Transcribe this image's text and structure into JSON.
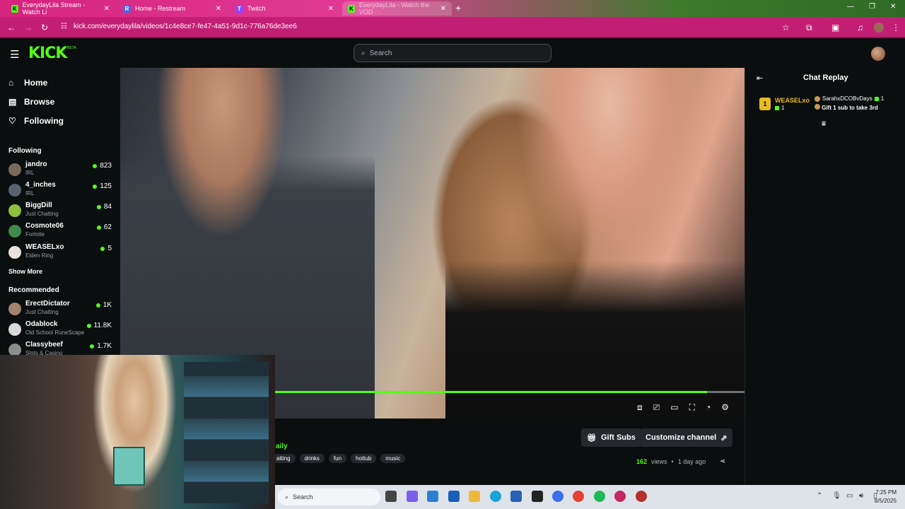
{
  "browser": {
    "tabs": [
      {
        "label": "EverydayLila Stream - Watch Li",
        "fav": "K",
        "fav_color": "#53fc18"
      },
      {
        "label": "Home - Restream",
        "fav": "R",
        "fav_color": "#4a63e6"
      },
      {
        "label": "Twitch",
        "fav": "T",
        "fav_color": "#9146ff"
      },
      {
        "label": "EverydayLila - Watch the VOD",
        "fav": "K",
        "fav_color": "#53fc18"
      }
    ],
    "url": "kick.com/everydaylila/videos/1c4e8ce7-fe47-4a51-9d1c-776a76de3ee6",
    "new_tab": "+"
  },
  "header": {
    "logo": "KICK",
    "beta": "BETA",
    "search_placeholder": "Search"
  },
  "sidebar": {
    "nav": [
      {
        "label": "Home",
        "icon": "home-icon"
      },
      {
        "label": "Browse",
        "icon": "browse-icon"
      },
      {
        "label": "Following",
        "icon": "heart-icon"
      }
    ],
    "following_title": "Following",
    "following": [
      {
        "name": "jandro",
        "category": "IRL",
        "viewers": "823",
        "color": "#7b6a5c"
      },
      {
        "name": "4_inches",
        "category": "IRL",
        "viewers": "125",
        "color": "#596370"
      },
      {
        "name": "BiggDill",
        "category": "Just Chatting",
        "viewers": "84",
        "color": "#8fbf3c"
      },
      {
        "name": "Cosmote06",
        "category": "Fortnite",
        "viewers": "62",
        "color": "#3f8a4a"
      },
      {
        "name": "WEASELxo",
        "category": "Elden Ring",
        "viewers": "5",
        "color": "#e9e3dc"
      }
    ],
    "show_more": "Show More",
    "recommended_title": "Recommended",
    "recommended": [
      {
        "name": "ErectDictator",
        "category": "Just Chatting",
        "viewers": "1K",
        "color": "#a38470"
      },
      {
        "name": "Odablock",
        "category": "Old School RuneScape",
        "viewers": "11.8K",
        "color": "#d9d9d9"
      },
      {
        "name": "Classybeef",
        "category": "Slots & Casino",
        "viewers": "1.7K",
        "color": "#8d8d8d"
      }
    ]
  },
  "video": {
    "progress": 0.94
  },
  "below_video": {
    "gift_subs": "Gift Subs",
    "customize": "Customize channel",
    "channel_title_fragment": "aily",
    "tags": [
      "atting",
      "drinks",
      "fun",
      "hottub",
      "music"
    ],
    "views_count": "162",
    "views_label": "views",
    "age": "1 day ago"
  },
  "chat": {
    "title": "Chat Replay",
    "leader_rank": "1",
    "leader_name": "WEASELxo",
    "leader_subs": "1",
    "runner_name": "SarahxDCOBvDays",
    "runner_subs": "1",
    "gift_prompt": "Gift 1 sub to take 3rd"
  },
  "taskbar": {
    "search": "Search",
    "time": "7:25 PM",
    "date": "8/5/2025"
  }
}
